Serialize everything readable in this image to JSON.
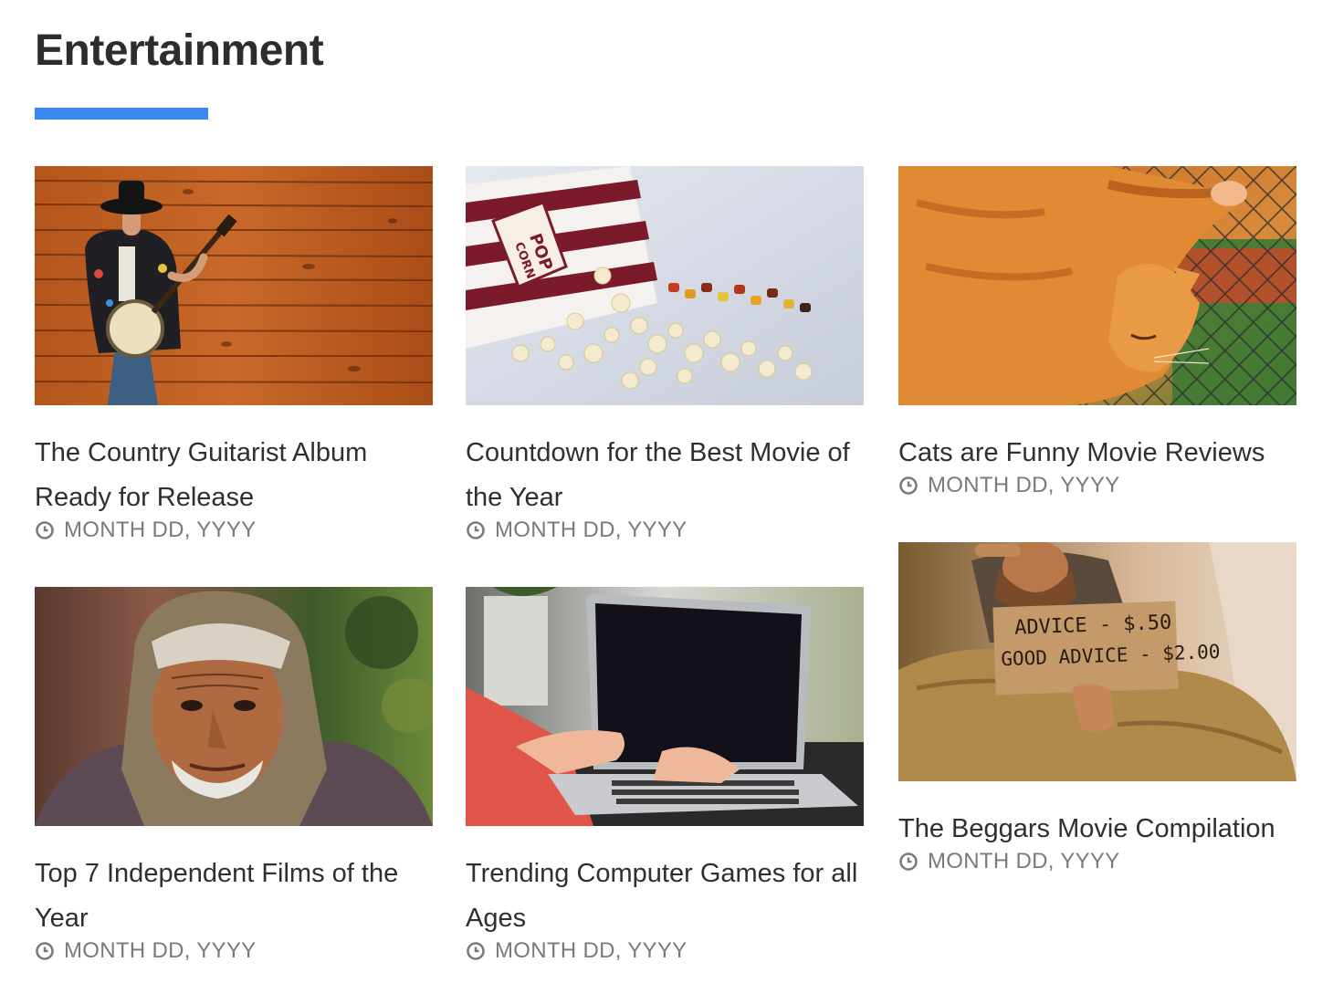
{
  "section": {
    "title": "Entertainment",
    "accent_color": "#3b86f0"
  },
  "articles": [
    {
      "title": "The Country Guitarist Album Ready for Release",
      "date": "MONTH DD, YYYY",
      "image": "banjo-player-wood-wall"
    },
    {
      "title": "Countdown for the Best Movie of the Year",
      "date": "MONTH DD, YYYY",
      "image": "spilled-popcorn-box"
    },
    {
      "title": "Cats are Funny Movie Reviews",
      "date": "MONTH DD, YYYY",
      "image": "orange-cat-fence"
    },
    {
      "title": "Top 7 Independent Films of the Year",
      "date": "MONTH DD, YYYY",
      "image": "old-man-hood-portrait"
    },
    {
      "title": "Trending Computer Games for all Ages",
      "date": "MONTH DD, YYYY",
      "image": "hands-typing-laptop"
    },
    {
      "title": "The Beggars Movie Compilation",
      "date": "MONTH DD, YYYY",
      "image": "man-holding-sign",
      "sign_text": [
        "ADVICE - $.50",
        "GOOD ADVICE - $2.00"
      ]
    }
  ],
  "icons": {
    "date": "clock-icon"
  }
}
